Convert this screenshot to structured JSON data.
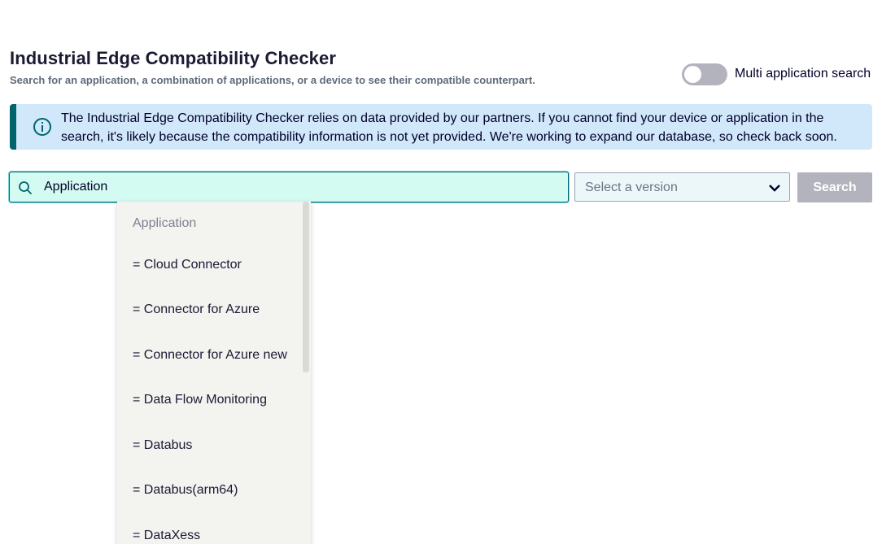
{
  "header": {
    "title": "Industrial Edge Compatibility Checker",
    "subtitle": "Search for an application, a combination of applications, or a device to see their compatible counterpart."
  },
  "toggle": {
    "label": "Multi application search",
    "enabled": false
  },
  "banner": {
    "icon": "info-icon",
    "text": "The Industrial Edge Compatibility Checker relies on data provided by our partners. If you cannot find your device or application in the search, it's likely because the compatibility information is not yet provided. We're working to expand our database, so check back soon."
  },
  "search": {
    "value": "Application",
    "icon": "search-icon"
  },
  "version": {
    "placeholder": "Select a version"
  },
  "search_button": {
    "label": "Search"
  },
  "dropdown": {
    "header": "Application",
    "items": [
      "= Cloud Connector",
      "= Connector for Azure",
      "= Connector for Azure new",
      "= Data Flow Monitoring",
      "= Databus",
      "= Databus(arm64)",
      "= DataXess"
    ]
  },
  "colors": {
    "accent": "#00646e",
    "banner_bg": "#d1e7fa",
    "search_bg": "#d4fbf1",
    "button_disabled": "#b3b3be"
  }
}
